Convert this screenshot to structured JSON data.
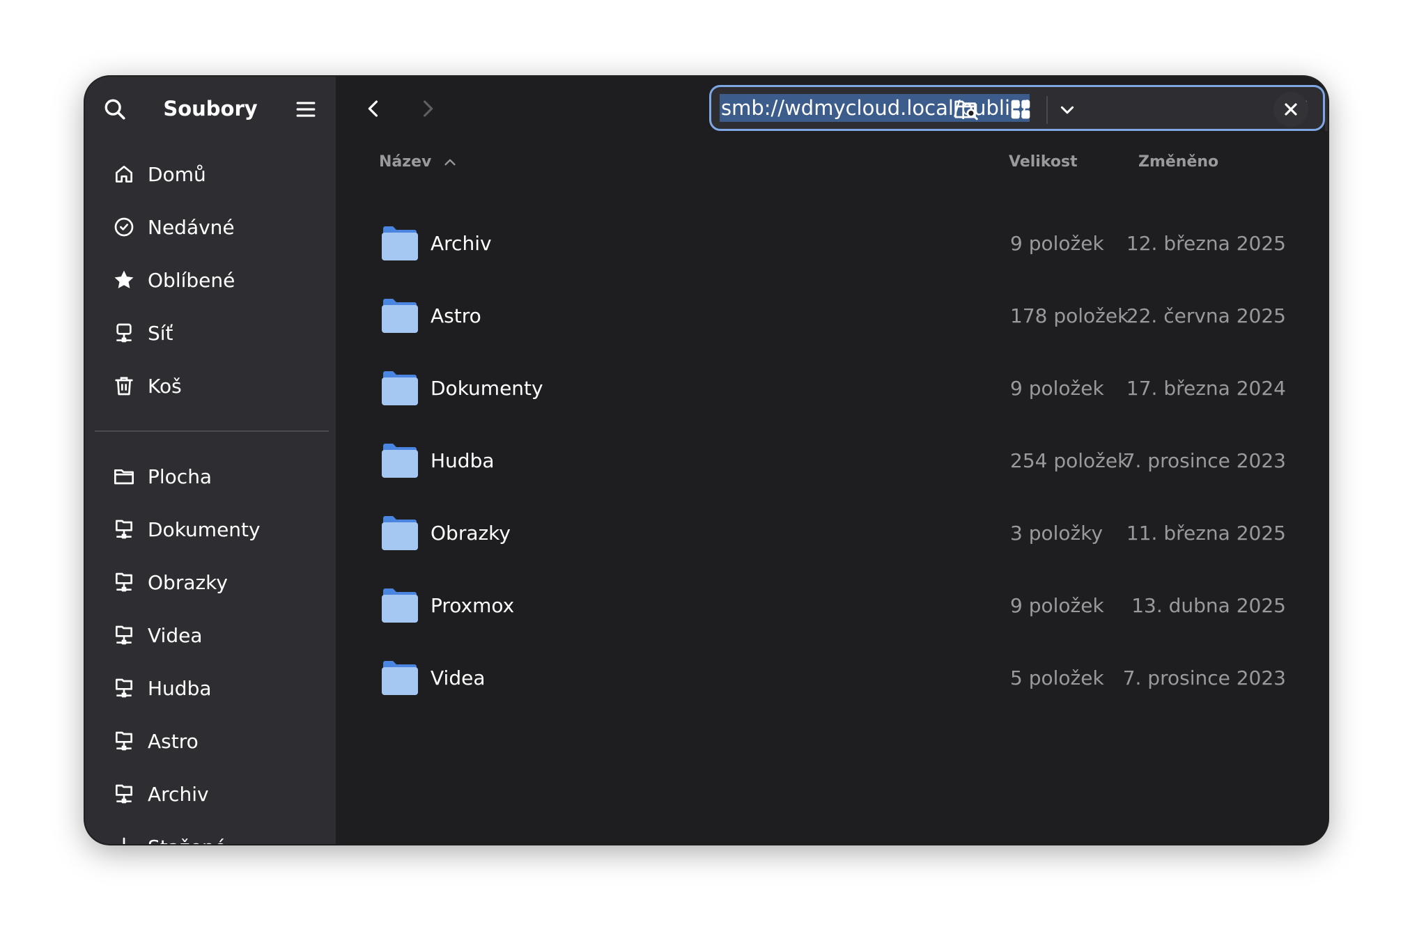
{
  "app": {
    "title": "Soubory"
  },
  "sidebar": {
    "places": [
      {
        "label": "Domů",
        "icon": "home-icon"
      },
      {
        "label": "Nedávné",
        "icon": "clock-icon"
      },
      {
        "label": "Oblíbené",
        "icon": "star-icon"
      },
      {
        "label": "Síť",
        "icon": "network-icon"
      },
      {
        "label": "Koš",
        "icon": "trash-icon"
      }
    ],
    "bookmarks": [
      {
        "label": "Plocha",
        "icon": "folder-outline-icon"
      },
      {
        "label": "Dokumenty",
        "icon": "network-folder-icon"
      },
      {
        "label": "Obrazky",
        "icon": "network-folder-icon"
      },
      {
        "label": "Videa",
        "icon": "network-folder-icon"
      },
      {
        "label": "Hudba",
        "icon": "network-folder-icon"
      },
      {
        "label": "Astro",
        "icon": "network-folder-icon"
      },
      {
        "label": "Archiv",
        "icon": "network-folder-icon"
      },
      {
        "label": "Stažené",
        "icon": "download-icon"
      }
    ]
  },
  "location": {
    "value": "smb://wdmycloud.local/public/"
  },
  "columns": {
    "name": "Název",
    "size": "Velikost",
    "modified": "Změněno"
  },
  "files": [
    {
      "name": "Archiv",
      "size": "9 položek",
      "modified": "12. března 2025"
    },
    {
      "name": "Astro",
      "size": "178 položek",
      "modified": "22. června 2025"
    },
    {
      "name": "Dokumenty",
      "size": "9 položek",
      "modified": "17. března 2024"
    },
    {
      "name": "Hudba",
      "size": "254 položek",
      "modified": "7. prosince 2023"
    },
    {
      "name": "Obrazky",
      "size": "3 položky",
      "modified": "11. března 2025"
    },
    {
      "name": "Proxmox",
      "size": "9 položek",
      "modified": "13. dubna 2025"
    },
    {
      "name": "Videa",
      "size": "5 položek",
      "modified": "7. prosince 2023"
    }
  ],
  "colors": {
    "accent": "#7ea7e3",
    "selection": "#3c5c8c",
    "folder": "#a5c8f2",
    "sidebar_bg": "#2e2e32",
    "content_bg": "#1e1e20"
  }
}
